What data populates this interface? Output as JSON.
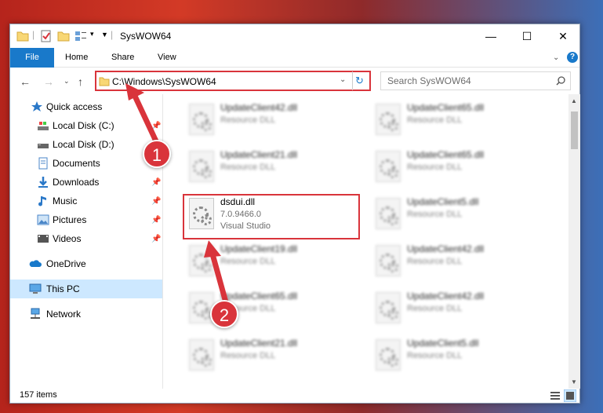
{
  "window": {
    "title": "SysWOW64",
    "minimize": "—",
    "maximize": "☐",
    "close": "✕"
  },
  "ribbon": {
    "tabs": [
      "File",
      "Home",
      "Share",
      "View"
    ],
    "help": "?"
  },
  "address": {
    "path": "C:\\Windows\\SysWOW64",
    "search_placeholder": "Search SysWOW64"
  },
  "nav": {
    "items": [
      {
        "label": "Quick access",
        "pinned": false
      },
      {
        "label": "Local Disk (C:)",
        "pinned": true
      },
      {
        "label": "Local Disk (D:)",
        "pinned": true
      },
      {
        "label": "Documents",
        "pinned": true
      },
      {
        "label": "Downloads",
        "pinned": true
      },
      {
        "label": "Music",
        "pinned": true
      },
      {
        "label": "Pictures",
        "pinned": true
      },
      {
        "label": "Videos",
        "pinned": true
      },
      {
        "label": "OneDrive",
        "pinned": false
      },
      {
        "label": "This PC",
        "pinned": false
      },
      {
        "label": "Network",
        "pinned": false
      }
    ]
  },
  "files": {
    "left": [
      {
        "name": "UpdateClient42.dll",
        "desc": "Resource DLL"
      },
      {
        "name": "UpdateClient21.dll",
        "desc": "Resource DLL"
      },
      {
        "name": "dsdui.dll",
        "desc": "7.0.9466.0",
        "publisher": "Visual Studio"
      },
      {
        "name": "UpdateClient19.dll",
        "desc": "Resource DLL"
      },
      {
        "name": "UpdateClient65.dll",
        "desc": "Resource DLL"
      },
      {
        "name": "UpdateClient21.dll",
        "desc": "Resource DLL"
      }
    ],
    "right": [
      {
        "name": "UpdateClient65.dll",
        "desc": "Resource DLL"
      },
      {
        "name": "UpdateClient65.dll",
        "desc": "Resource DLL"
      },
      {
        "name": "UpdateClient5.dll",
        "desc": "Resource DLL"
      },
      {
        "name": "UpdateClient42.dll",
        "desc": "Resource DLL"
      },
      {
        "name": "UpdateClient42.dll",
        "desc": "Resource DLL"
      },
      {
        "name": "UpdateClient5.dll",
        "desc": "Resource DLL"
      }
    ]
  },
  "status": {
    "item_count": "157 items"
  },
  "annotations": {
    "step1": "1",
    "step2": "2"
  },
  "colors": {
    "highlight": "#d9343b",
    "file_tab": "#1979ca",
    "selected": "#cde8ff"
  }
}
